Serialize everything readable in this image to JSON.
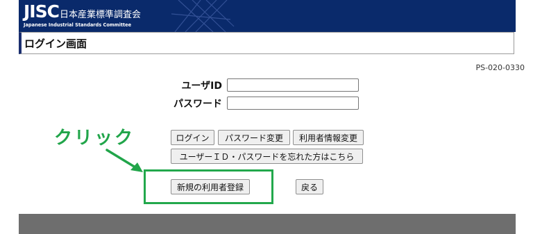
{
  "header": {
    "logo_mark": "JISC",
    "logo_ja": "日本産業標準調査会",
    "logo_en": "Japanese Industrial Standards Committee"
  },
  "page": {
    "title": "ログイン画面",
    "screen_id": "PS-020-0330"
  },
  "form": {
    "user_id_label": "ユーザID",
    "user_id_value": "",
    "password_label": "パスワード",
    "password_value": ""
  },
  "buttons": {
    "login": "ログイン",
    "change_password": "パスワード変更",
    "change_user_info": "利用者情報変更",
    "forgot": "ユーザーＩＤ・パスワードを忘れた方はこちら",
    "new_registration": "新規の利用者登録",
    "back": "戻る"
  },
  "annotation": {
    "click_text": "クリック",
    "highlight_color": "#22a84c"
  },
  "colors": {
    "banner": "#0a2a6b",
    "footer": "#6e6e6e"
  }
}
